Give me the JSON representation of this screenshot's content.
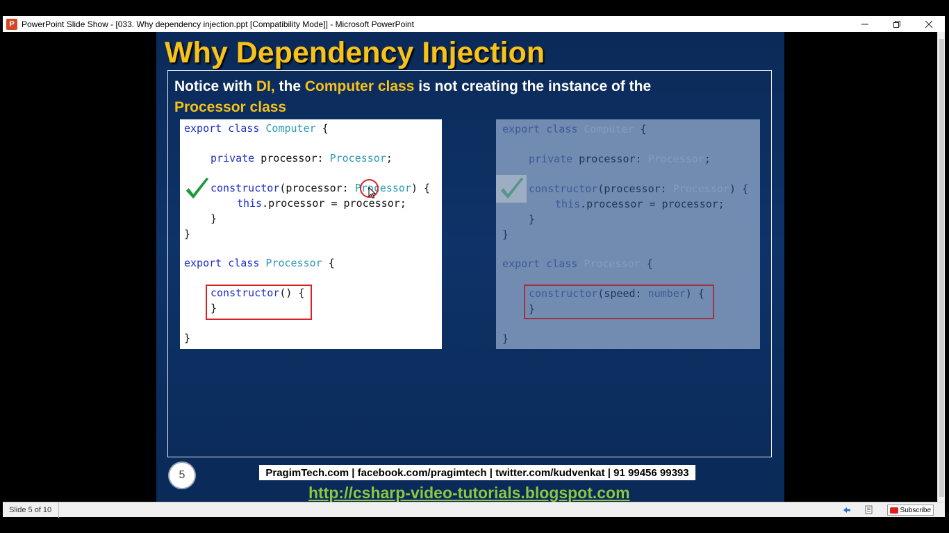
{
  "window": {
    "title": "PowerPoint Slide Show - [033. Why dependency injection.ppt [Compatibility Mode]] - Microsoft PowerPoint",
    "app_icon_letter": "P",
    "minimize_icon": "minimize-icon",
    "maximize_icon": "restore-icon",
    "close_icon": "close-icon"
  },
  "slide": {
    "title": "Why Dependency Injection",
    "notice": {
      "t1": "Notice with ",
      "t2": "DI,",
      "t3": " the ",
      "t4": "Computer class",
      "t5": " is not creating the instance of the ",
      "t6": "Processor class"
    },
    "left_code": {
      "l1": [
        "export class ",
        "Computer",
        " {"
      ],
      "l2": [
        "private",
        " processor: ",
        "Processor",
        ";"
      ],
      "l3": [
        "constructor",
        "(processor: ",
        "Processor",
        ") {"
      ],
      "l4": [
        "this",
        ".processor = processor;"
      ],
      "l5": "}",
      "l6": "}",
      "l7": [
        "export class ",
        "Processor",
        " {"
      ],
      "l8": [
        "constructor",
        "() {"
      ],
      "l9": "}",
      "l10": "}"
    },
    "right_code": {
      "l1": [
        "export class ",
        "Computer",
        " {"
      ],
      "l2": [
        "private",
        " processor: ",
        "Processor",
        ";"
      ],
      "l3": [
        "constructor",
        "(processor: ",
        "Processor",
        ") {"
      ],
      "l4": [
        "this",
        ".processor = processor;"
      ],
      "l5": "}",
      "l6": "}",
      "l7": [
        "export class ",
        "Processor",
        " {"
      ],
      "l8": [
        "constructor",
        "(speed: ",
        "number",
        ") {"
      ],
      "l9": "}",
      "l10": "}"
    },
    "slide_number": "5",
    "contact": "PragimTech.com | facebook.com/pragimtech | twitter.com/kudvenkat | 91 99456 99393",
    "blog_url": "http://csharp-video-tutorials.blogspot.com"
  },
  "statusbar": {
    "slide_indicator": "Slide 5 of 10",
    "subscribe_label": "Subscribe"
  },
  "colors": {
    "title_yellow": "#f6c21b",
    "slide_bg": "#0e3368",
    "link_green": "#8ec63f",
    "check_green": "#1a9a3a",
    "redbox": "#d62222"
  }
}
